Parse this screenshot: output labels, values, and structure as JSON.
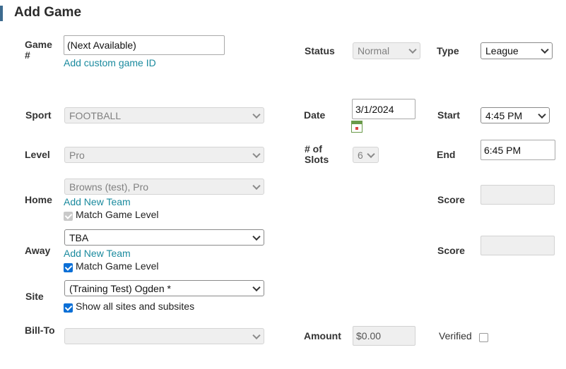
{
  "page": {
    "title": "Add Game"
  },
  "game": {
    "label": "Game #",
    "value": "(Next Available)",
    "add_custom_link": "Add custom game ID"
  },
  "status": {
    "label": "Status",
    "selected": "Normal"
  },
  "type": {
    "label": "Type",
    "selected": "League"
  },
  "sport": {
    "label": "Sport",
    "selected": "FOOTBALL"
  },
  "date": {
    "label": "Date",
    "value": "3/1/2024",
    "icon": "calendar-icon"
  },
  "start": {
    "label": "Start",
    "selected": "4:45 PM"
  },
  "level": {
    "label": "Level",
    "selected": "Pro"
  },
  "slots": {
    "label": "# of Slots",
    "selected": "6"
  },
  "end": {
    "label": "End",
    "value": "6:45 PM"
  },
  "home": {
    "label": "Home",
    "selected": "Browns (test), Pro",
    "add_team_link": "Add New Team",
    "match_level_label": "Match Game Level",
    "match_level_checked": true,
    "score_label": "Score",
    "score_value": ""
  },
  "away": {
    "label": "Away",
    "selected": "TBA",
    "add_team_link": "Add New Team",
    "match_level_label": "Match Game Level",
    "match_level_checked": true,
    "score_label": "Score",
    "score_value": ""
  },
  "site": {
    "label": "Site",
    "selected": "(Training Test) Ogden *",
    "show_all_label": "Show all sites and subsites",
    "show_all_checked": true
  },
  "bill_to": {
    "label": "Bill-To",
    "selected": ""
  },
  "amount": {
    "label": "Amount",
    "value": "$0.00"
  },
  "verified": {
    "label": "Verified",
    "checked": false
  },
  "colors": {
    "accent_bar": "#3d6b8f",
    "link": "#1a8a9e",
    "checkbox": "#0b6fd6"
  }
}
